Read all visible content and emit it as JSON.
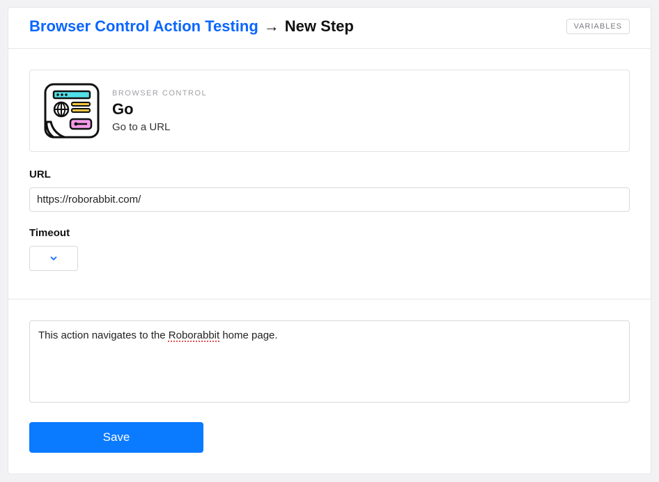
{
  "header": {
    "breadcrumb_link": "Browser Control Action Testing",
    "breadcrumb_arrow": "→",
    "breadcrumb_current": "New Step",
    "variables_button": "VARIABLES"
  },
  "action": {
    "category": "BROWSER CONTROL",
    "title": "Go",
    "subtitle": "Go to a URL"
  },
  "fields": {
    "url_label": "URL",
    "url_value": "https://roborabbit.com/",
    "timeout_label": "Timeout",
    "timeout_value": ""
  },
  "description": {
    "pre": "This action navigates to the ",
    "flagged": "Roborabbit",
    "post": " home page."
  },
  "buttons": {
    "save": "Save"
  }
}
